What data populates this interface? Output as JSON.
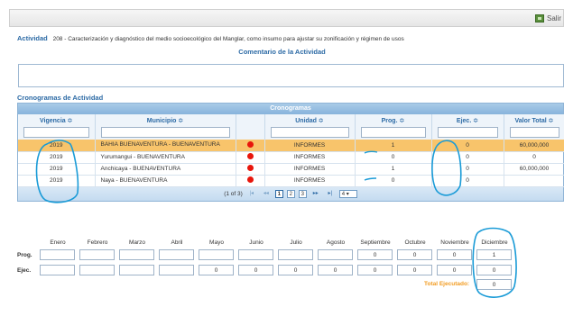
{
  "toolbar": {
    "salir_label": "Salir"
  },
  "actividad": {
    "label": "Actividad",
    "text": "208 - Caracterización y diagnóstico del medio socioecológico del Manglar, como insumo para ajustar su zonificación y régimen de usos"
  },
  "comentario": {
    "title": "Comentario de la Actividad",
    "value": ""
  },
  "cronogramas": {
    "section_title": "Cronogramas de Actividad",
    "grid_title": "Cronogramas",
    "columns": [
      "Vigencia ≎",
      "Municipio ≎",
      "",
      "Unidad ≎",
      "Prog. ≎",
      "Ejec. ≎",
      "Valor Total ≎"
    ],
    "rows": [
      {
        "vigencia": "2019",
        "municipio": "BAHIA BUENAVENTURA - BUENAVENTURA",
        "unidad": "INFORMES",
        "prog": "1",
        "ejec": "0",
        "valor": "60,000,000",
        "selected": true
      },
      {
        "vigencia": "2019",
        "municipio": "Yurumangui - BUENAVENTURA",
        "unidad": "INFORMES",
        "prog": "0",
        "ejec": "0",
        "valor": "0",
        "selected": false
      },
      {
        "vigencia": "2019",
        "municipio": "Anchicaya - BUENAVENTURA",
        "unidad": "INFORMES",
        "prog": "1",
        "ejec": "0",
        "valor": "60,000,000",
        "selected": false
      },
      {
        "vigencia": "2019",
        "municipio": "Naya - BUENAVENTURA",
        "unidad": "INFORMES",
        "prog": "0",
        "ejec": "0",
        "valor": "",
        "selected": false
      }
    ],
    "pager": {
      "info": "(1 of 3)",
      "first": "|◂",
      "prev": "◂◂",
      "pages": [
        "1",
        "2",
        "3"
      ],
      "next": "▸▸",
      "last": "▸|",
      "per_page": "4 ▾"
    }
  },
  "mensual": {
    "months": [
      "Enero",
      "Febrero",
      "Marzo",
      "Abril",
      "Mayo",
      "Junio",
      "Julio",
      "Agosto",
      "Septiembre",
      "Octubre",
      "Noviembre",
      "Diciembre"
    ],
    "prog_label": "Prog.",
    "ejec_label": "Ejec.",
    "prog": [
      "",
      "",
      "",
      "",
      "",
      "",
      "",
      "",
      "0",
      "0",
      "0",
      "1"
    ],
    "ejec": [
      "",
      "",
      "",
      "",
      "0",
      "0",
      "0",
      "0",
      "0",
      "0",
      "0",
      "0"
    ],
    "total_label": "Total Ejecutado:",
    "total_value": "0"
  },
  "colors": {
    "accent": "#2c6aa5",
    "selected_row": "#f8c46b",
    "status_dot": "#e8150b",
    "annotation": "#1a9bd7",
    "total_label": "#f29b1f"
  }
}
